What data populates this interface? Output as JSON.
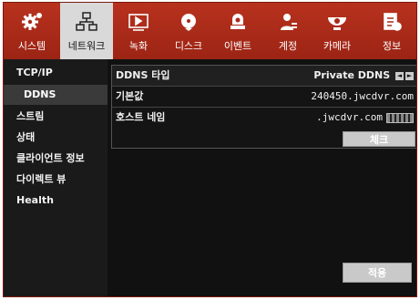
{
  "colors": {
    "accent": "#a8291a",
    "background": "#0b0b0b",
    "active_tab": "#d9d9d9"
  },
  "toolbar": {
    "items": [
      {
        "label": "시스템",
        "icon": "gear-icon"
      },
      {
        "label": "네트워크",
        "icon": "network-icon"
      },
      {
        "label": "녹화",
        "icon": "record-icon"
      },
      {
        "label": "디스크",
        "icon": "disk-icon"
      },
      {
        "label": "이벤트",
        "icon": "event-icon"
      },
      {
        "label": "계정",
        "icon": "account-icon"
      },
      {
        "label": "카메라",
        "icon": "camera-icon"
      },
      {
        "label": "정보",
        "icon": "info-icon"
      }
    ],
    "active_label": "네트워크"
  },
  "sidebar": {
    "items": [
      {
        "label": "TCP/IP"
      },
      {
        "label": "DDNS"
      },
      {
        "label": "스트림"
      },
      {
        "label": "상태"
      },
      {
        "label": "클라이언트 정보"
      },
      {
        "label": "다이렉트 뷰"
      },
      {
        "label": "Health"
      }
    ],
    "active_label": "DDNS"
  },
  "ddns": {
    "type_label": "DDNS 타입",
    "type_value": "Private DDNS",
    "prev_arrow": "◄",
    "next_arrow": "►",
    "default_label": "기본값",
    "default_value": "240450.jwcdvr.com",
    "host_label": "호스트 네임",
    "host_value": ".jwcdvr.com",
    "check_button": "체크"
  },
  "apply_button": "적용"
}
